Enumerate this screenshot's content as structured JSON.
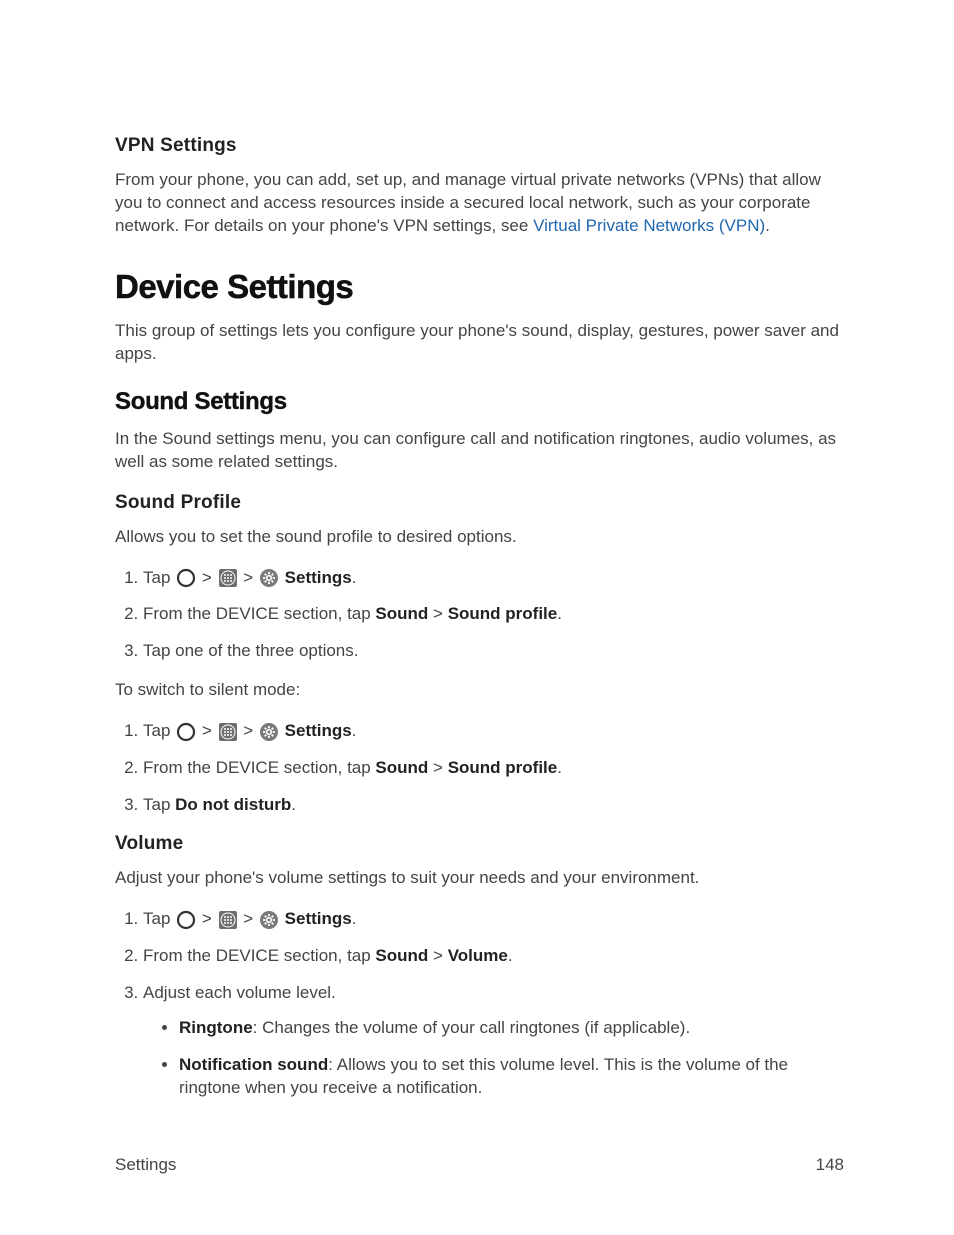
{
  "vpn": {
    "heading": "VPN Settings",
    "p1_a": "From your phone, you can add, set up, and manage virtual private networks (VPNs) that allow you to connect and access resources inside a secured local network, such as your corporate network. For details on your phone's VPN settings, see ",
    "p1_link": "Virtual Private Networks (VPN)",
    "p1_b": "."
  },
  "device": {
    "heading": "Device Settings",
    "p": "This group of settings lets you configure your phone's sound, display, gestures, power saver and apps."
  },
  "sound": {
    "heading": "Sound Settings",
    "p": "In the Sound settings menu, you can configure call and notification ringtones, audio volumes, as well as some related settings."
  },
  "profile": {
    "heading": "Sound Profile",
    "p": "Allows you to set the sound profile to desired options.",
    "step1_a": "Tap ",
    "step1_b": " > ",
    "step1_c": " > ",
    "step1_settings": "Settings",
    "step1_d": ".",
    "step2_a": "From the DEVICE section, tap ",
    "step2_sound": "Sound",
    "step2_gt": " > ",
    "step2_soundprofile": "Sound profile",
    "step2_b": ".",
    "step3": "Tap one of the three options.",
    "silent_intro": "To switch to silent mode:",
    "s_step3_a": "Tap ",
    "s_step3_dnd": "Do not disturb",
    "s_step3_b": "."
  },
  "volume": {
    "heading": "Volume",
    "p": "Adjust your phone's volume settings to suit your needs and your environment.",
    "step2_a": "From the DEVICE section, tap ",
    "step2_sound": "Sound",
    "step2_gt": " > ",
    "step2_vol": "Volume",
    "step2_b": ".",
    "step3": "Adjust each volume level.",
    "bul1_label": "Ringtone",
    "bul1_text": ": Changes the volume of your call ringtones (if applicable).",
    "bul2_label": "Notification sound",
    "bul2_text": ": Allows you to set this volume level. This is the volume of the ringtone when you receive a notification."
  },
  "footer": {
    "left": "Settings",
    "right": "148"
  }
}
